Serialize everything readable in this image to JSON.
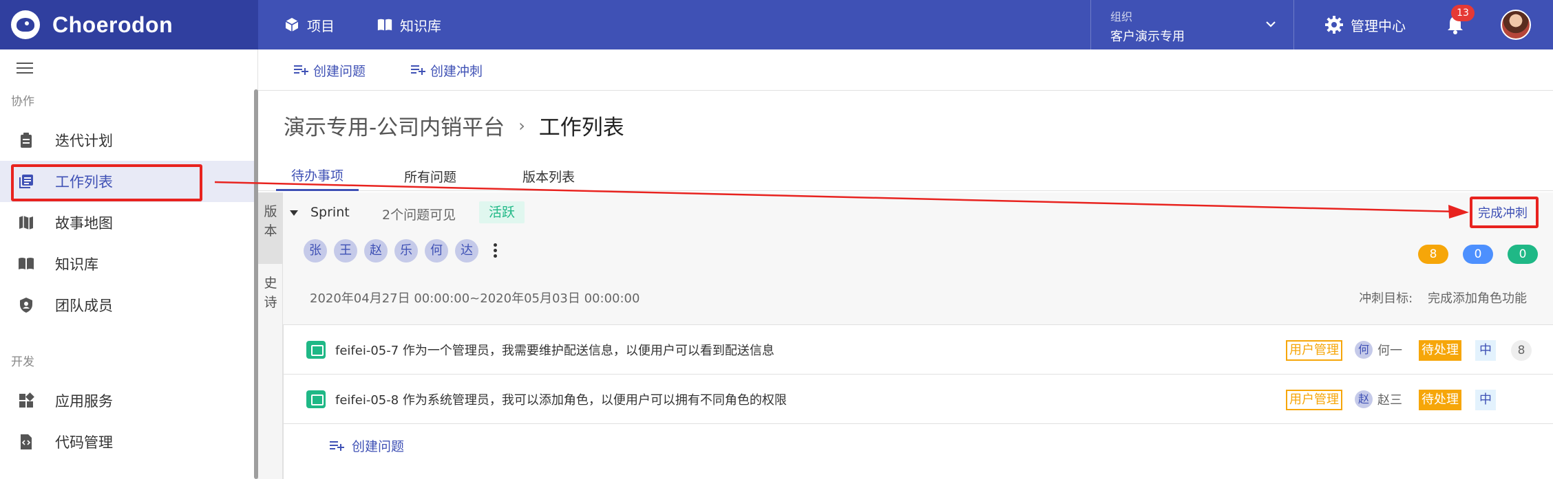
{
  "header": {
    "logo_text": "Choerodon",
    "nav": [
      {
        "label": "项目",
        "icon": "cube-icon"
      },
      {
        "label": "知识库",
        "icon": "book-icon"
      }
    ],
    "org_label": "组织",
    "org_value": "客户演示专用",
    "admin_label": "管理中心",
    "notification_count": "13"
  },
  "sidebar": {
    "sections": [
      {
        "label": "协作"
      },
      {
        "label": "开发"
      }
    ],
    "items": [
      {
        "label": "迭代计划",
        "icon": "clipboard-icon"
      },
      {
        "label": "工作列表",
        "icon": "list-icon",
        "active": true
      },
      {
        "label": "故事地图",
        "icon": "map-icon"
      },
      {
        "label": "知识库",
        "icon": "book-icon"
      },
      {
        "label": "团队成员",
        "icon": "shield-icon"
      },
      {
        "label": "应用服务",
        "icon": "apps-icon"
      },
      {
        "label": "代码管理",
        "icon": "code-file-icon"
      }
    ]
  },
  "toolbar": {
    "create_issue": "创建问题",
    "create_sprint": "创建冲刺"
  },
  "breadcrumb": {
    "project": "演示专用-公司内销平台",
    "separator": "›",
    "current": "工作列表"
  },
  "tabs": [
    "待办事项",
    "所有问题",
    "版本列表"
  ],
  "vtabs": [
    "版本",
    "史诗"
  ],
  "sprint": {
    "name": "Sprint",
    "issue_count": "2个问题可见",
    "status": "活跃",
    "complete_label": "完成冲刺",
    "members": [
      "张",
      "王",
      "赵",
      "乐",
      "何",
      "达"
    ],
    "counts": [
      {
        "value": "8",
        "color": "#f6a609"
      },
      {
        "value": "0",
        "color": "#4d90fe"
      },
      {
        "value": "0",
        "color": "#1fb886"
      }
    ],
    "date_range": "2020年04月27日 00:00:00~2020年05月03日 00:00:00",
    "goal_label": "冲刺目标:",
    "goal_value": "完成添加角色功能"
  },
  "issues": [
    {
      "text": "feifei-05-7 作为一个管理员，我需要维护配送信息，以便用户可以看到配送信息",
      "epic": "用户管理",
      "assignee_initial": "何",
      "assignee": "何一",
      "status": "待处理",
      "priority": "中",
      "points": "8"
    },
    {
      "text": "feifei-05-8 作为系统管理员，我可以添加角色，以便用户可以拥有不同角色的权限",
      "epic": "用户管理",
      "assignee_initial": "赵",
      "assignee": "赵三",
      "status": "待处理",
      "priority": "中",
      "points": ""
    }
  ],
  "create_issue_label": "创建问题",
  "colors": {
    "header": "#3f51b5",
    "logo_bg": "#303f9f",
    "accent": "#3f51b5",
    "annotation": "#e8231f",
    "status_active": "#1fb886",
    "tag_orange": "#f6a609"
  }
}
